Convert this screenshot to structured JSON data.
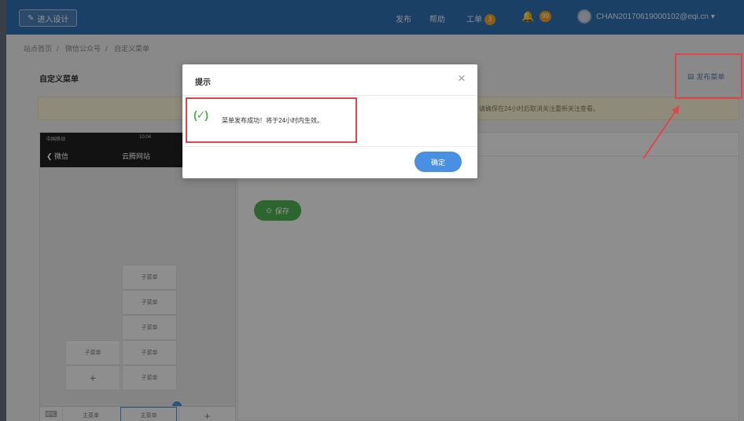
{
  "topnav": {
    "enter_design_label": "进入设计",
    "links": {
      "publish": "发布",
      "help": "帮助",
      "tickets": "工单"
    },
    "tickets_badge": "3",
    "notifications_badge": "99",
    "account": "CHAN20170619000102@eqi.cn"
  },
  "breadcrumb": [
    "站点首页",
    "微信公众号",
    "自定义菜单"
  ],
  "page": {
    "title": "自定义菜单",
    "publish_label": "发布菜单",
    "notice": "请确保在24小时后取消关注重新关注查看。"
  },
  "phone": {
    "status_carrier": "中国移动",
    "status_time": "10:04",
    "back_label": "微信",
    "account_name": "云腾网站",
    "submenus_right": [
      "子菜单",
      "子菜单",
      "子菜单",
      "子菜单",
      "子菜单"
    ],
    "submenus_left": [
      "子菜单",
      "+"
    ],
    "menu_tabs": [
      "主菜单",
      "主菜单",
      "+"
    ]
  },
  "editor": {
    "save_label": "保存"
  },
  "dialog": {
    "title": "提示",
    "close": "×",
    "success_icon": "(✓)",
    "message": "菜单发布成功！将于24小时内生效。",
    "ok_label": "确定"
  },
  "colors": {
    "nav": "#2f6fb0",
    "highlight": "#e0454a",
    "success": "#4caf50",
    "primary": "#4a90e2"
  }
}
